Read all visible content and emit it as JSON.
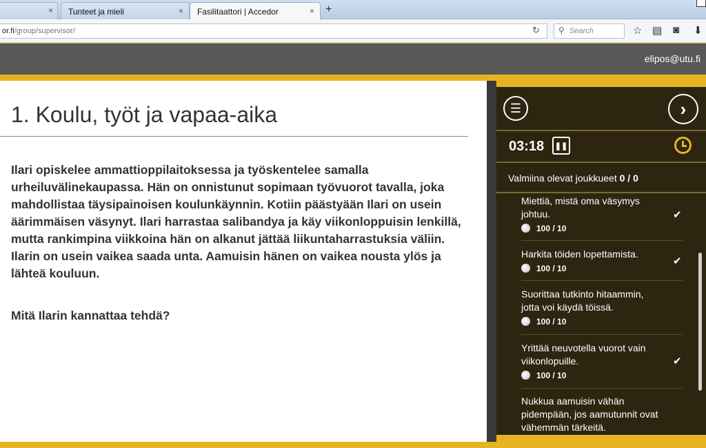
{
  "browser": {
    "tabs": [
      {
        "label": ""
      },
      {
        "label": "Tunteet ja mieli"
      },
      {
        "label": "Fasilitaattori | Accedor"
      }
    ],
    "close_glyph": "×",
    "new_tab_glyph": "+",
    "url_domain": "or.fi",
    "url_path": "/group/supervisor/",
    "search_placeholder": "Search"
  },
  "header": {
    "user": "elipos@utu.fi"
  },
  "question": {
    "title": "1. Koulu, työt ja vapaa-aika",
    "text": "Ilari opiskelee ammattioppilaitoksessa ja työskentelee samalla urheiluvälinekaupassa. Hän on onnistunut sopimaan työvuorot tavalla, joka mahdollistaa täysipainoisen koulunkäynnin. Kotiin päästyään Ilari on usein äärimmäisen väsynyt. Ilari harrastaa salibandya ja käy viikonloppuisin lenkillä, mutta rankimpina viikkoina hän on alkanut jättää liikuntaharrastuksia väliin. Ilarin on usein vaikea  saada unta. Aamuisin hänen on vaikea nousta ylös ja lähteä kouluun.",
    "ask": "Mitä Ilarin kannattaa tehdä?"
  },
  "panel": {
    "timer": "03:18",
    "ready_label": "Valmiina olevat joukkueet",
    "ready_count": "0 / 0",
    "options": [
      {
        "label": "Miettiä, mistä oma väsymys johtuu.",
        "score": "100 / 10",
        "checked": true
      },
      {
        "label": "Harkita töiden lopettamista.",
        "score": "100 / 10",
        "checked": true
      },
      {
        "label": "Suorittaa tutkinto hitaammin, jotta voi käydä töissä.",
        "score": "100 / 10",
        "checked": false
      },
      {
        "label": "Yrittää neuvotella vuorot vain viikonlopuille.",
        "score": "100 / 10",
        "checked": true
      },
      {
        "label": "Nukkua aamuisin vähän pidempään, jos aamutunnit ovat vähemmän tärkeitä.",
        "score": "",
        "checked": false
      }
    ]
  },
  "colors": {
    "accent": "#e6b422",
    "panel_bg": "#2d2510",
    "header_bg": "#585858"
  }
}
